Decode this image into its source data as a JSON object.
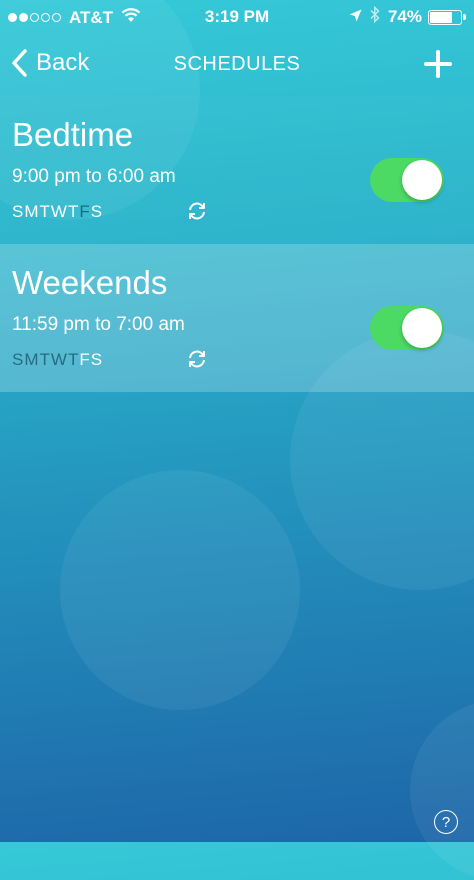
{
  "status_bar": {
    "signal_strength": 2,
    "signal_max": 5,
    "carrier": "AT&T",
    "wifi_icon": "wifi-icon",
    "time": "3:19 PM",
    "location_icon": "location-arrow-icon",
    "bluetooth_icon": "bluetooth-icon",
    "battery_percent": "74%",
    "battery_level": 0.74
  },
  "nav": {
    "back_label": "Back",
    "title": "SCHEDULES",
    "add_icon": "plus-icon"
  },
  "schedules": [
    {
      "name": "Bedtime",
      "time": "9:00 pm to 6:00 am",
      "days": [
        {
          "letter": "S",
          "active": true
        },
        {
          "letter": "M",
          "active": true
        },
        {
          "letter": "T",
          "active": true
        },
        {
          "letter": "W",
          "active": true
        },
        {
          "letter": "T",
          "active": true
        },
        {
          "letter": "F",
          "active": false
        },
        {
          "letter": "S",
          "active": true
        }
      ],
      "repeat_icon": "repeat-icon",
      "enabled": true
    },
    {
      "name": "Weekends",
      "time": "11:59 pm to 7:00 am",
      "days": [
        {
          "letter": "S",
          "active": false
        },
        {
          "letter": "M",
          "active": false
        },
        {
          "letter": "T",
          "active": false
        },
        {
          "letter": "W",
          "active": false
        },
        {
          "letter": "T",
          "active": false
        },
        {
          "letter": "F",
          "active": true
        },
        {
          "letter": "S",
          "active": true
        }
      ],
      "repeat_icon": "repeat-icon",
      "enabled": true
    }
  ],
  "help": {
    "label": "?"
  },
  "colors": {
    "toggle_on": "#4cd964",
    "day_active": "#ffffff",
    "day_inactive": "#0a3f55"
  }
}
